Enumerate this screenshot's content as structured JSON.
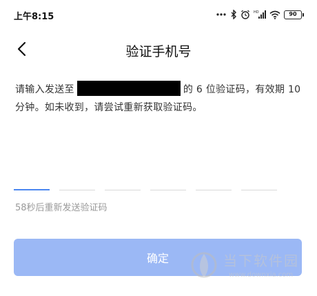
{
  "status_bar": {
    "time": "上午8:15",
    "battery": "90"
  },
  "header": {
    "title": "验证手机号"
  },
  "description": {
    "prefix": "请输入发送至",
    "suffix": "的 6 位验证码，有效期 10 分钟。如未收到，请尝试重新获取验证码。"
  },
  "code_input": {
    "length": 6,
    "active_index": 0
  },
  "resend_text": "58秒后重新发送验证码",
  "confirm_button": {
    "label": "确定"
  },
  "watermark": {
    "name": "当下软件园",
    "url": "www.downxia.com"
  },
  "colors": {
    "accent": "#4a86f0",
    "button_disabled": "#9bb8f5"
  }
}
